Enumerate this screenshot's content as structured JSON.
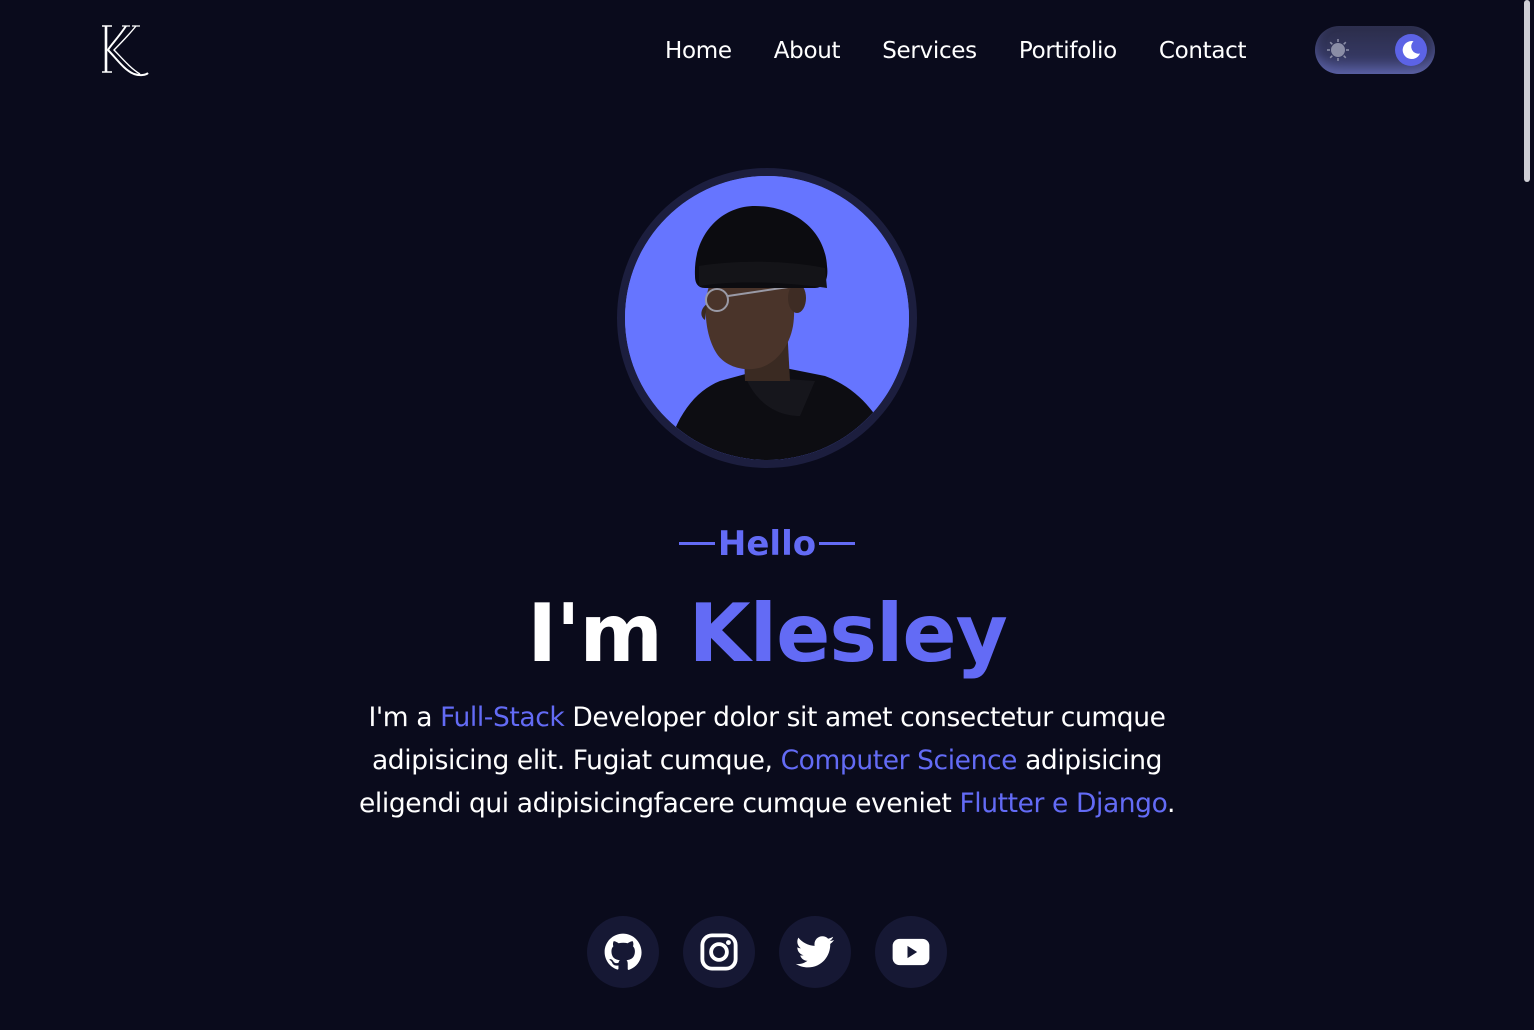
{
  "brand": {
    "logo_letter": "K"
  },
  "nav": {
    "items": [
      {
        "label": "Home"
      },
      {
        "label": "About"
      },
      {
        "label": "Services"
      },
      {
        "label": "Portifolio"
      },
      {
        "label": "Contact"
      }
    ]
  },
  "theme_toggle": {
    "mode": "dark",
    "icons": [
      "sun-icon",
      "moon-icon"
    ]
  },
  "hero": {
    "greeting": "Hello",
    "headline_prefix": "I'm",
    "headline_name": "Klesley",
    "intro": {
      "p1": "I'm a ",
      "h1": "Full-Stack",
      "p2": " Developer dolor sit amet consectetur cumque adipisicing elit. Fugiat cumque, ",
      "h2": "Computer Science",
      "p3": " adipisicing eligendi qui adipisicingfacere cumque eveniet ",
      "h3": "Flutter e Django",
      "p4": "."
    }
  },
  "socials": [
    {
      "icon": "github-icon"
    },
    {
      "icon": "instagram-icon"
    },
    {
      "icon": "twitter-icon"
    },
    {
      "icon": "youtube-icon"
    }
  ],
  "colors": {
    "background": "#0a0b1c",
    "accent": "#636bf5",
    "avatar_bg": "#6675ff",
    "social_bg": "#161834"
  }
}
